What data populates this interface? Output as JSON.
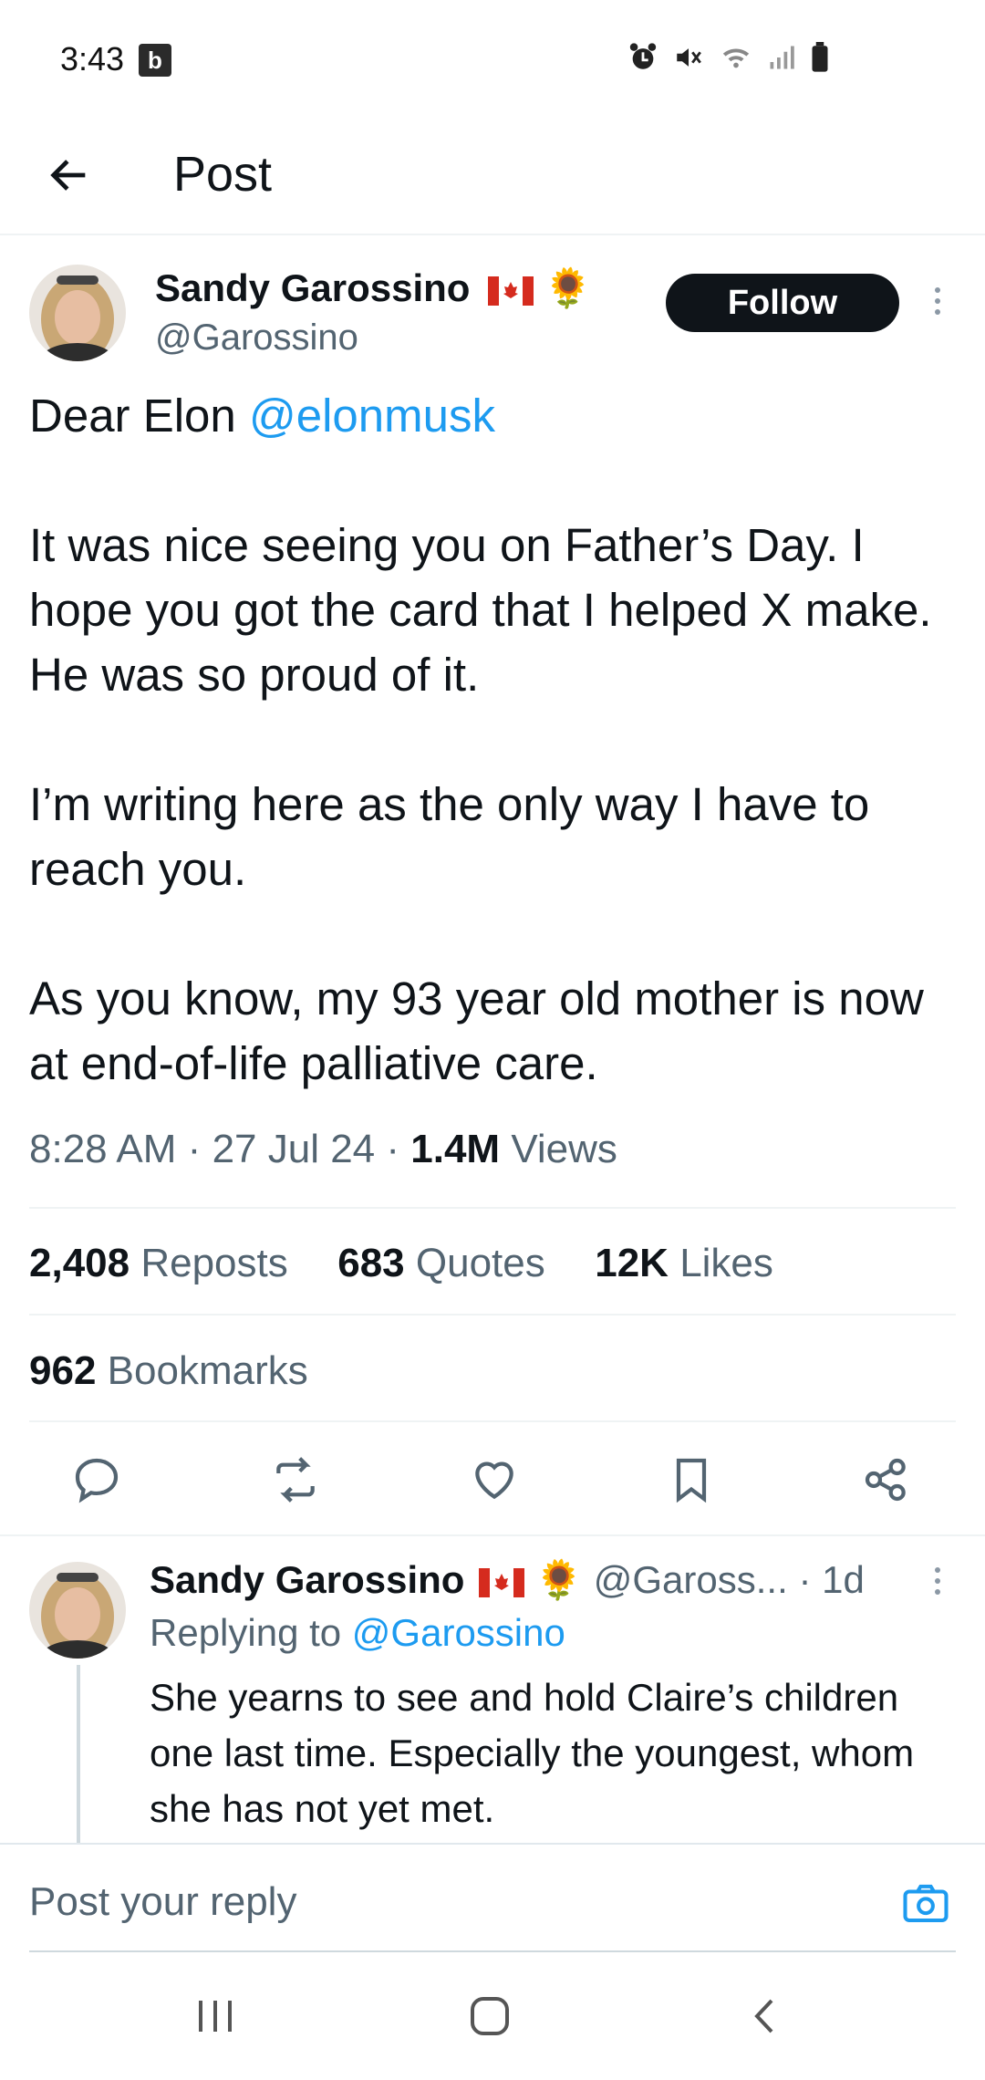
{
  "status_bar": {
    "time": "3:43",
    "app_badge": "b",
    "icons": [
      "alarm-icon",
      "mute-icon",
      "wifi-icon",
      "signal-icon",
      "battery-icon"
    ]
  },
  "header": {
    "title": "Post",
    "back_icon": "arrow-left-icon"
  },
  "post": {
    "author_name": "Sandy Garossino",
    "author_emoji": "🌻",
    "handle": "@Garossino",
    "follow_label": "Follow",
    "text": {
      "line1_prefix": "Dear Elon ",
      "line1_mention": "@elonmusk",
      "para2": "It was nice seeing you on Father’s Day. I hope you got the card that I helped X make. He was so proud of it.",
      "para3": "I’m writing here as the only way I have to reach you.",
      "para4": "As you know, my 93 year old mother is now at end-of-life palliative care."
    },
    "time": "8:28 AM",
    "date": "27 Jul 24",
    "views_count": "1.4M",
    "views_label": "Views",
    "sep": "·",
    "reposts_count": "2,408",
    "reposts_label": "Reposts",
    "quotes_count": "683",
    "quotes_label": "Quotes",
    "likes_count": "12K",
    "likes_label": "Likes",
    "bookmarks_count": "962",
    "bookmarks_label": "Bookmarks"
  },
  "reply": {
    "author_name": "Sandy Garossino",
    "author_emoji": "🌻",
    "handle": "@Gaross...",
    "age": "· 1d",
    "replying_prefix": "Replying to ",
    "replying_handle": "@Garossino",
    "text": "She yearns to see and hold Claire’s children one last time. Especially the youngest, whom she has not yet met."
  },
  "composer": {
    "placeholder": "Post your reply",
    "camera_icon": "camera-icon"
  },
  "colors": {
    "accent": "#1d9bf0",
    "text": "#0f1419",
    "secondary": "#536471",
    "divider": "#eff3f4"
  }
}
